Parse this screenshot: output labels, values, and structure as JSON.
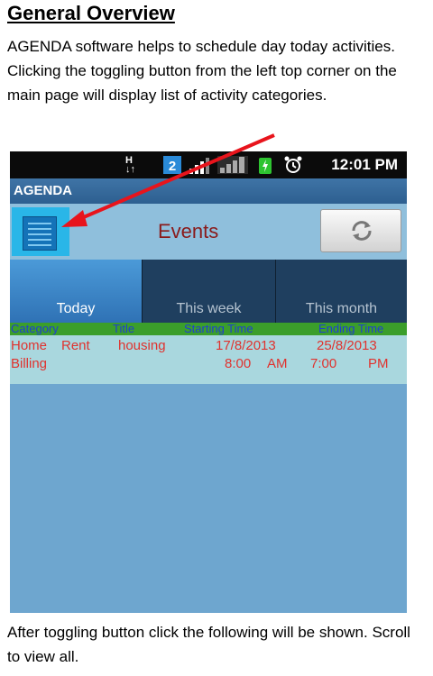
{
  "doc": {
    "heading": "General Overview",
    "intro": "AGENDA software helps to schedule day today activities. Clicking the toggling button from the left top corner on the main page will display list of activity categories.",
    "outro": "After toggling button click the following will be shown. Scroll to view all."
  },
  "phone": {
    "status": {
      "time": "12:01 PM",
      "icons": [
        "data-arrows-icon",
        "network-2-icon",
        "signal-bars-icon",
        "wifi-bars-icon",
        "battery-charging-icon",
        "alarm-icon"
      ]
    },
    "app_title": "AGENDA",
    "toolbar": {
      "title": "Events",
      "menu_icon": "list-menu-icon",
      "refresh_icon": "refresh-icon"
    },
    "tabs": [
      "Today",
      "This week",
      "This month"
    ],
    "table": {
      "headers": [
        "Category",
        "Title",
        "Starting Time",
        "Ending Time"
      ],
      "rows": [
        [
          "Home",
          "Rent",
          "housing",
          "17/8/2013",
          "25/8/2013"
        ],
        [
          "Billing",
          "8:00",
          "AM",
          "7:00",
          "PM"
        ]
      ]
    },
    "colors": {
      "accent": "#29b6e8",
      "table_header": "#3b9e2b",
      "row_text": "#e0322e",
      "annotation_arrow": "#e8141c"
    }
  }
}
